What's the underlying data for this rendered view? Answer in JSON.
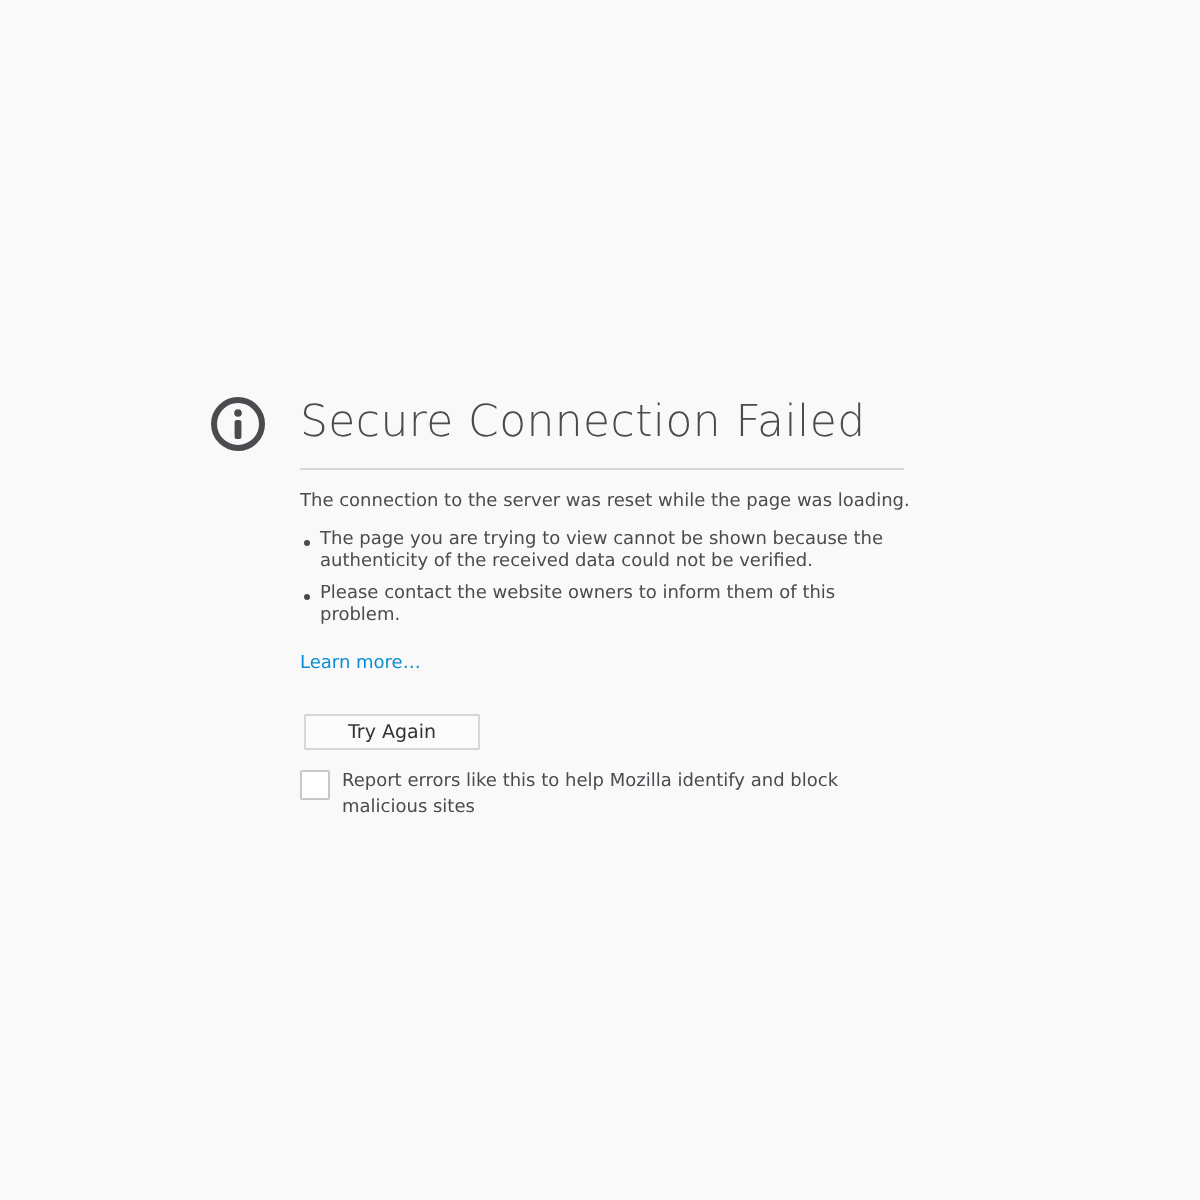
{
  "title": "Secure Connection Failed",
  "description": "The connection to the server was reset while the page was loading.",
  "bullets": [
    "The page you are trying to view cannot be shown because the authenticity of the received data could not be verified.",
    "Please contact the website owners to inform them of this problem."
  ],
  "learn_more": "Learn more…",
  "try_again_button": "Try Again",
  "report_checkbox": {
    "label": "Report errors like this to help Mozilla identify and block malicious sites",
    "checked": false
  }
}
